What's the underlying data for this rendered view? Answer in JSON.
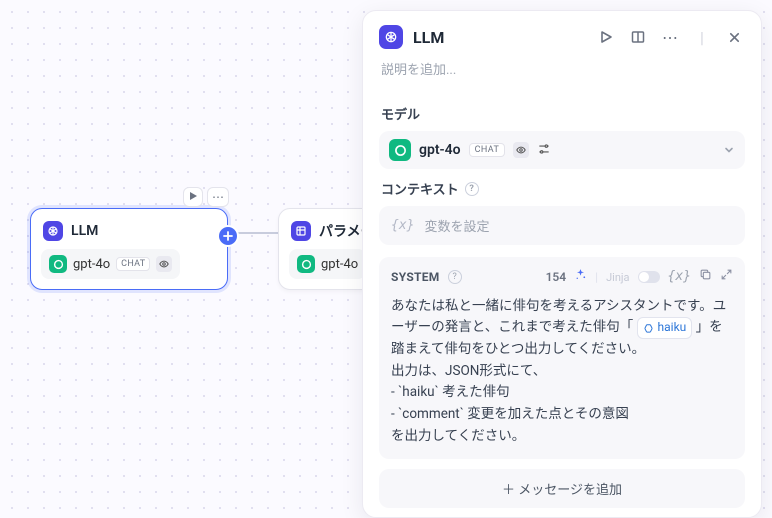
{
  "canvas": {
    "node1": {
      "title": "LLM",
      "model": "gpt-4o",
      "chat_badge": "CHAT"
    },
    "node2": {
      "title": "パラメー",
      "model": "gpt-4o"
    }
  },
  "panel": {
    "title": "LLM",
    "description_placeholder": "説明を追加...",
    "model_section": "モデル",
    "model_name": "gpt-4o",
    "model_badge": "CHAT",
    "context_section": "コンテキスト",
    "context_placeholder": "変数を設定",
    "system_label": "SYSTEM",
    "token_count": "154",
    "jinja_label": "Jinja",
    "prompt_line1_a": "あなたは私と一緒に俳句を考えるアシスタントです。ユーザーの発言と、これまで考えた俳句「 ",
    "prompt_var": "haiku",
    "prompt_line1_b": " 」を踏まえて俳句をひとつ出力してください。",
    "prompt_line2": "出力は、JSON形式にて、",
    "prompt_line3": "- `haiku` 考えた俳句",
    "prompt_line4": "- `comment` 変更を加えた点とその意図",
    "prompt_line5": "を出力してください。",
    "add_message": "メッセージを追加"
  }
}
